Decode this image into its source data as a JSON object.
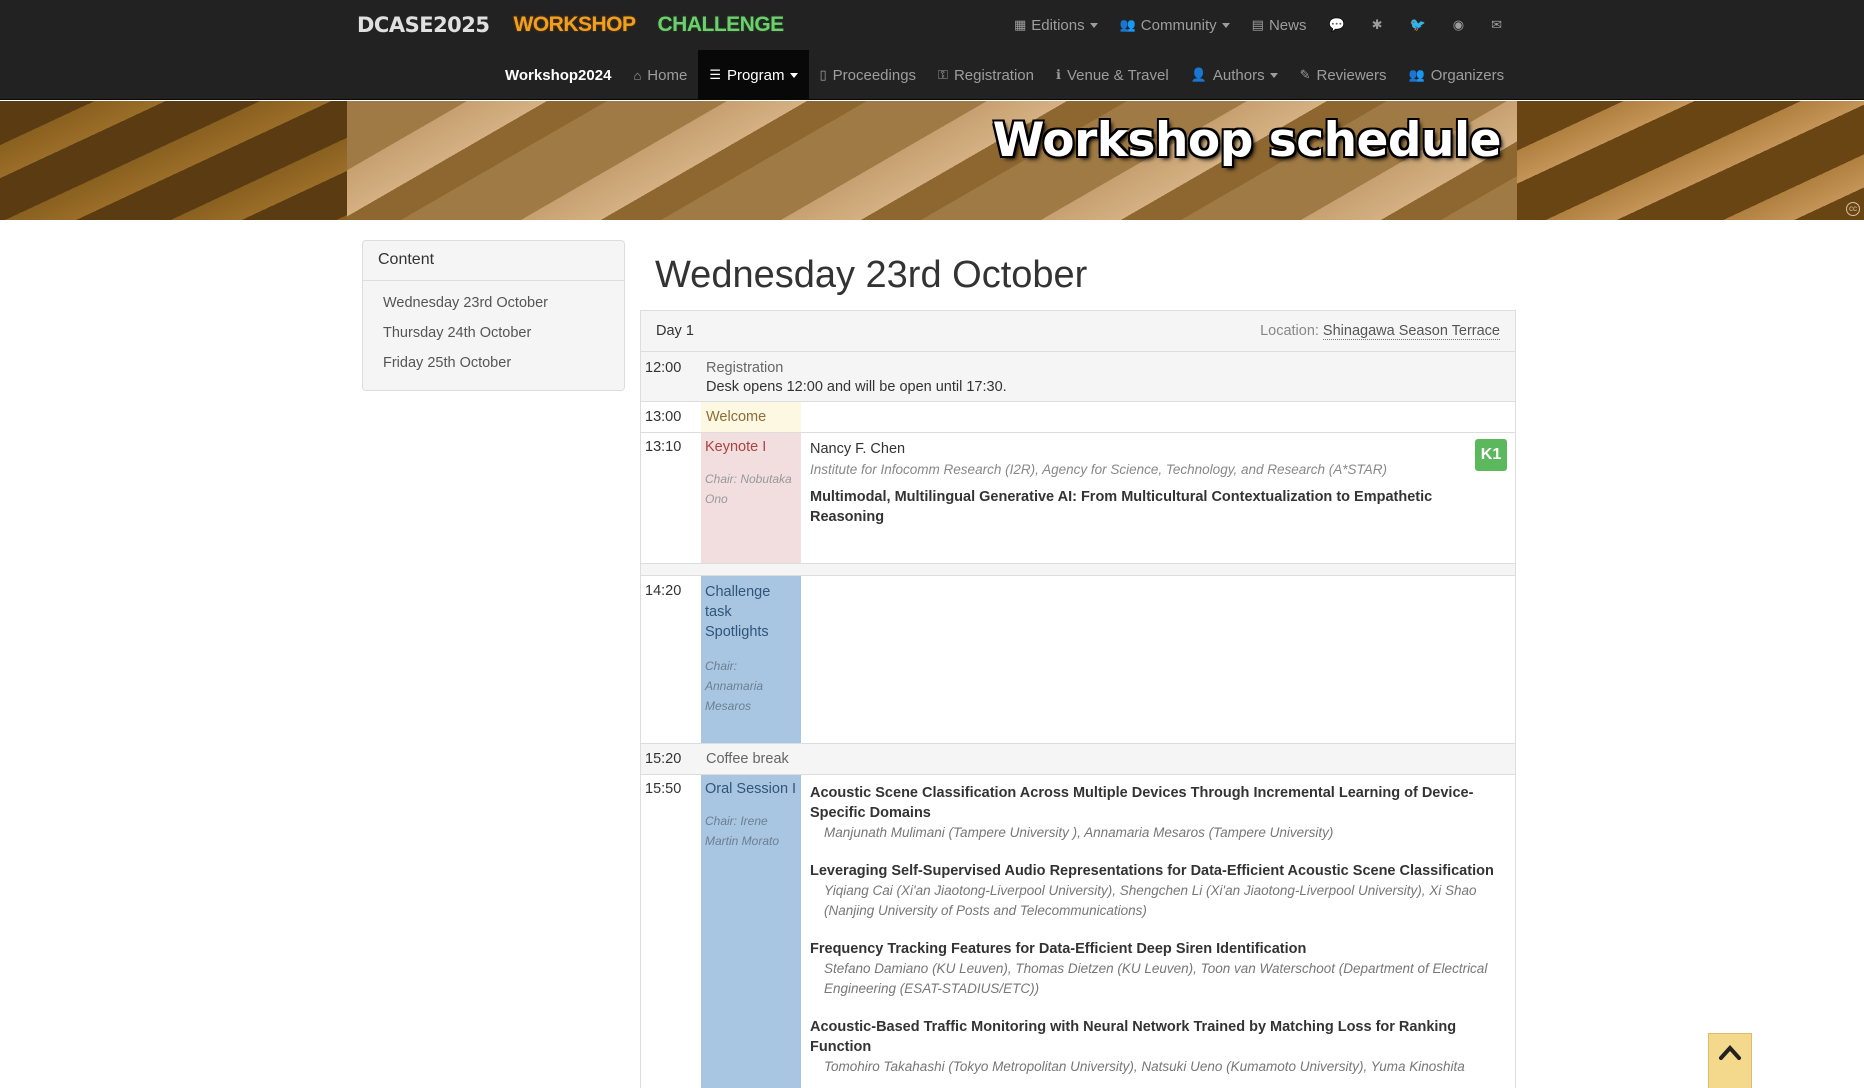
{
  "brand": {
    "dcase": "DCASE2025",
    "workshop": "WORKSHOP",
    "challenge": "CHALLENGE"
  },
  "topnav": {
    "editions": "Editions",
    "community": "Community",
    "news": "News",
    "icons": [
      "comments-icon",
      "slack-icon",
      "twitter-icon",
      "github-icon",
      "envelope-icon"
    ]
  },
  "subnav": {
    "brand": "Workshop2024",
    "items": [
      {
        "label": "Home",
        "icon": "home-icon"
      },
      {
        "label": "Program",
        "icon": "list-icon",
        "active": true
      },
      {
        "label": "Proceedings",
        "icon": "file-icon"
      },
      {
        "label": "Registration",
        "icon": "key-icon"
      },
      {
        "label": "Venue & Travel",
        "icon": "info-icon"
      },
      {
        "label": "Authors",
        "icon": "user-icon"
      },
      {
        "label": "Reviewers",
        "icon": "edit-icon"
      },
      {
        "label": "Organizers",
        "icon": "users-icon"
      }
    ]
  },
  "hero": {
    "title": "Workshop schedule"
  },
  "sidebar": {
    "heading": "Content",
    "links": [
      "Wednesday 23rd October",
      "Thursday 24th October",
      "Friday 25th October"
    ]
  },
  "main": {
    "day_title": "Wednesday 23rd October",
    "day_label": "Day 1",
    "location_label": "Location:",
    "location_value": "Shinagawa Season Terrace"
  },
  "schedule": {
    "registration": {
      "time": "12:00",
      "title": "Registration",
      "desc": "Desk opens 12:00 and will be open until 17:30."
    },
    "welcome": {
      "time": "13:00",
      "title": "Welcome"
    },
    "keynote": {
      "time": "13:10",
      "title": "Keynote I",
      "chair": "Chair: Nobutaka Ono",
      "badge": "K1",
      "speaker": "Nancy F. Chen",
      "affiliation": "Institute for Infocomm Research (I2R), Agency for Science, Technology, and Research (A*STAR)",
      "talk": "Multimodal, Multilingual Generative AI: From Multicultural Contextualization to Empathetic Reasoning"
    },
    "challenge": {
      "time": "14:20",
      "title": "Challenge task Spotlights",
      "chair": "Chair: Annamaria Mesaros"
    },
    "coffee": {
      "time": "15:20",
      "title": "Coffee break"
    },
    "oral": {
      "time": "15:50",
      "title": "Oral Session I",
      "chair": "Chair: Irene Martin Morato",
      "papers": [
        {
          "title": "Acoustic Scene Classification Across Multiple Devices Through Incremental Learning of Device-Specific Domains",
          "authors": "Manjunath Mulimani (Tampere University ), Annamaria Mesaros (Tampere University)"
        },
        {
          "title": "Leveraging Self-Supervised Audio Representations for Data-Efficient Acoustic Scene Classification",
          "authors": "Yiqiang Cai (Xi'an Jiaotong-Liverpool University), Shengchen Li (Xi'an Jiaotong-Liverpool University), Xi Shao (Nanjing University of Posts and Telecommunications)"
        },
        {
          "title": "Frequency Tracking Features for Data-Efficient Deep Siren Identification",
          "authors": "Stefano Damiano (KU Leuven), Thomas Dietzen (KU Leuven), Toon van Waterschoot (Department of Electrical Engineering (ESAT-STADIUS/ETC))"
        },
        {
          "title": "Acoustic-Based Traffic Monitoring with Neural Network Trained by Matching Loss for Ranking Function",
          "authors": "Tomohiro Takahashi (Tokyo Metropolitan University), Natsuki Ueno (Kumamoto University), Yuma Kinoshita"
        }
      ]
    }
  },
  "colors": {
    "navbar": "#222222",
    "keynote": "#f2dede",
    "session": "#a8c6e2",
    "welcome": "#fdf8e1",
    "badge": "#5cb85c",
    "totop": "#f4d98c"
  }
}
